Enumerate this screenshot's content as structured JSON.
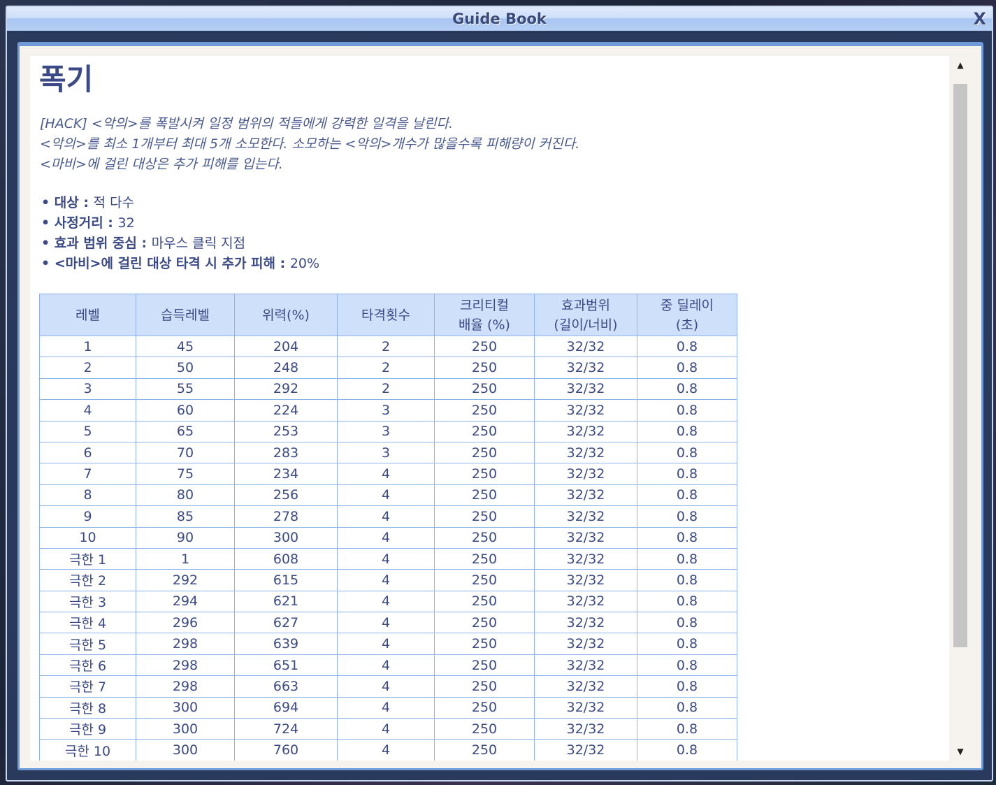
{
  "window": {
    "title": "Guide Book",
    "close_label": "X"
  },
  "skill": {
    "name": "폭기",
    "description": [
      "[HACK] <악의>를 폭발시켜 일정 범위의 적들에게 강력한 일격을 날린다.",
      "<악의>를 최소 1개부터 최대 5개 소모한다. 소모하는 <악의>개수가 많을수록 피해량이 커진다.",
      "<마비>에 걸린 대상은 추가 피해를 입는다."
    ],
    "properties": [
      {
        "label": "• 대상 : ",
        "value": "적 다수"
      },
      {
        "label": "• 사정거리 : ",
        "value": "32"
      },
      {
        "label": "• 효과 범위 중심 : ",
        "value": "마우스 클릭 지점"
      },
      {
        "label": "• <마비>에 걸린 대상 타격 시 추가 피해 : ",
        "value": "20%"
      }
    ]
  },
  "table": {
    "headers": [
      "레벨",
      "습득레벨",
      "위력(%)",
      "타격횟수",
      "크리티컬\n배율 (%)",
      "효과범위\n(길이/너비)",
      "중 딜레이\n(초)"
    ],
    "rows": [
      [
        "1",
        "45",
        "204",
        "2",
        "250",
        "32/32",
        "0.8"
      ],
      [
        "2",
        "50",
        "248",
        "2",
        "250",
        "32/32",
        "0.8"
      ],
      [
        "3",
        "55",
        "292",
        "2",
        "250",
        "32/32",
        "0.8"
      ],
      [
        "4",
        "60",
        "224",
        "3",
        "250",
        "32/32",
        "0.8"
      ],
      [
        "5",
        "65",
        "253",
        "3",
        "250",
        "32/32",
        "0.8"
      ],
      [
        "6",
        "70",
        "283",
        "3",
        "250",
        "32/32",
        "0.8"
      ],
      [
        "7",
        "75",
        "234",
        "4",
        "250",
        "32/32",
        "0.8"
      ],
      [
        "8",
        "80",
        "256",
        "4",
        "250",
        "32/32",
        "0.8"
      ],
      [
        "9",
        "85",
        "278",
        "4",
        "250",
        "32/32",
        "0.8"
      ],
      [
        "10",
        "90",
        "300",
        "4",
        "250",
        "32/32",
        "0.8"
      ],
      [
        "극한 1",
        "1",
        "608",
        "4",
        "250",
        "32/32",
        "0.8"
      ],
      [
        "극한 2",
        "292",
        "615",
        "4",
        "250",
        "32/32",
        "0.8"
      ],
      [
        "극한 3",
        "294",
        "621",
        "4",
        "250",
        "32/32",
        "0.8"
      ],
      [
        "극한 4",
        "296",
        "627",
        "4",
        "250",
        "32/32",
        "0.8"
      ],
      [
        "극한 5",
        "298",
        "639",
        "4",
        "250",
        "32/32",
        "0.8"
      ],
      [
        "극한 6",
        "298",
        "651",
        "4",
        "250",
        "32/32",
        "0.8"
      ],
      [
        "극한 7",
        "298",
        "663",
        "4",
        "250",
        "32/32",
        "0.8"
      ],
      [
        "극한 8",
        "300",
        "694",
        "4",
        "250",
        "32/32",
        "0.8"
      ],
      [
        "극한 9",
        "300",
        "724",
        "4",
        "250",
        "32/32",
        "0.8"
      ],
      [
        "극한 10",
        "300",
        "760",
        "4",
        "250",
        "32/32",
        "0.8"
      ]
    ]
  }
}
